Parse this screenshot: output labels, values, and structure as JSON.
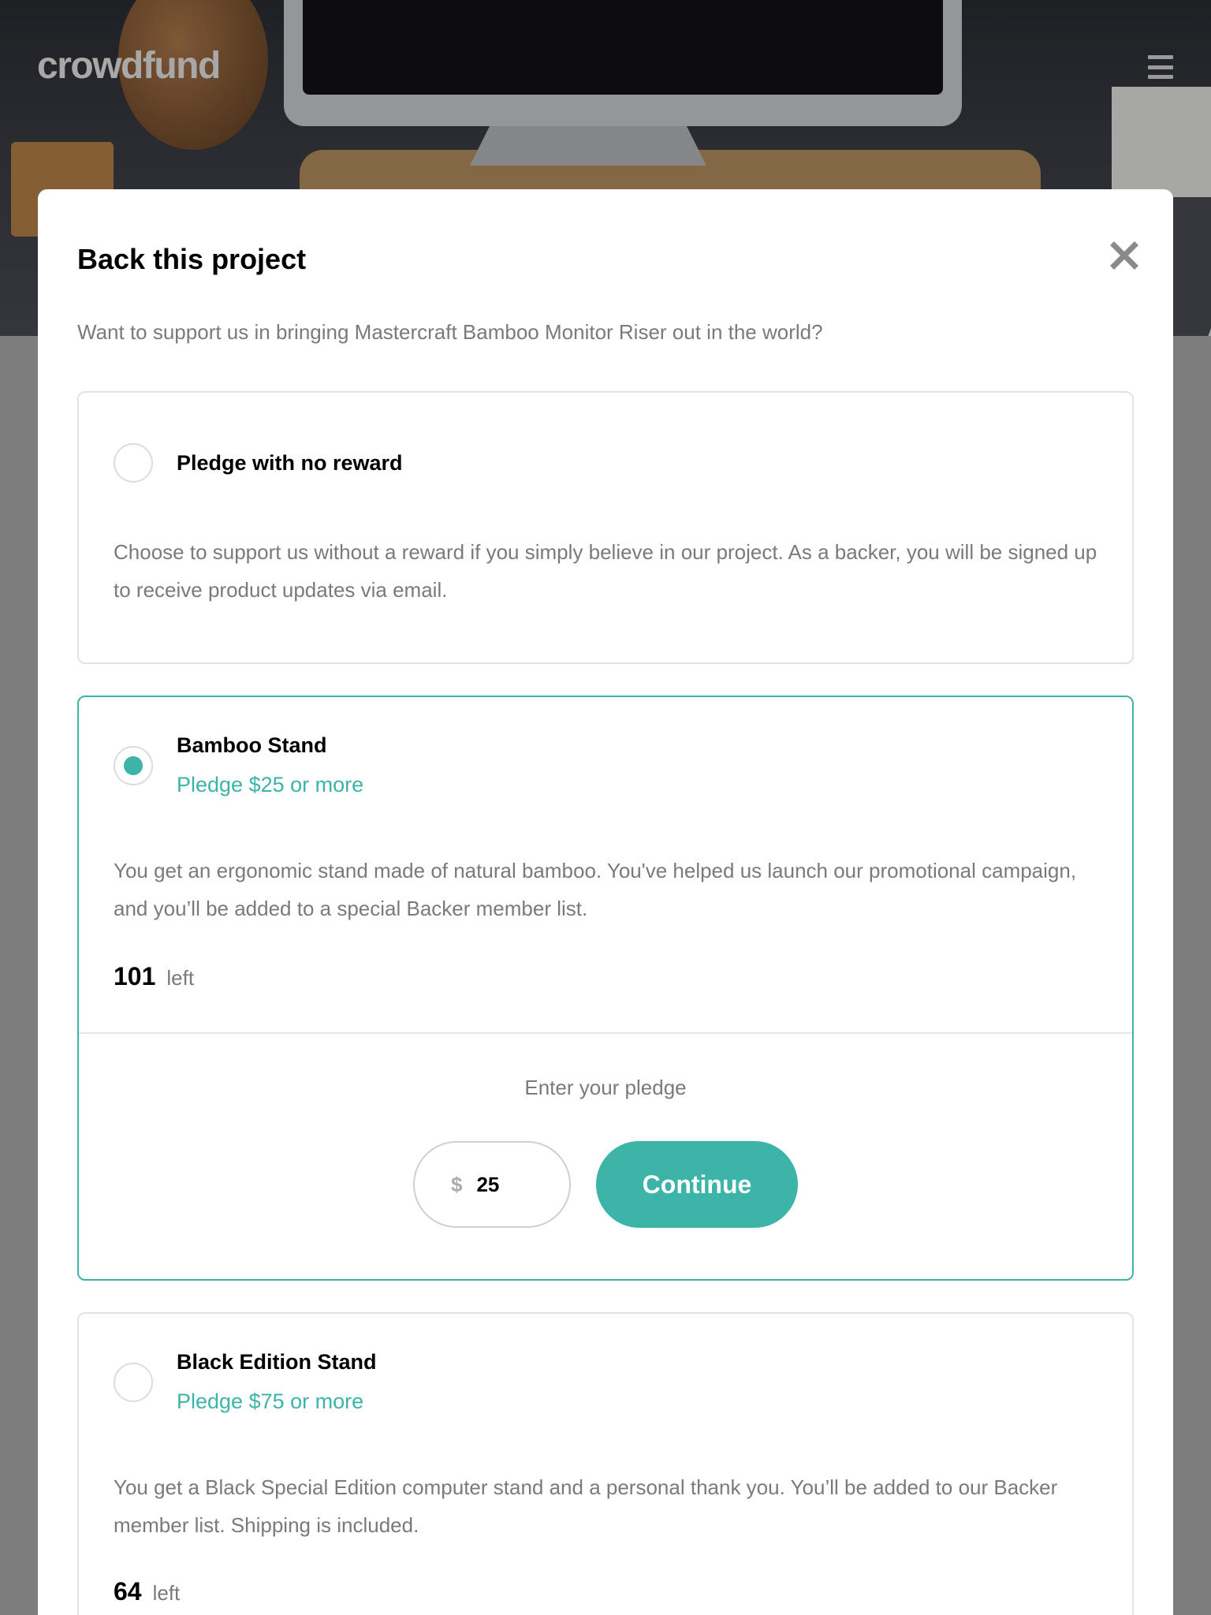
{
  "header": {
    "logo": "crowdfund",
    "menu_icon": "hamburger-menu-icon"
  },
  "modal": {
    "title": "Back this project",
    "close_icon": "close-icon",
    "subtitle": "Want to support us in bringing Mastercraft Bamboo Monitor Riser out in the world?"
  },
  "rewards": [
    {
      "title": "Pledge with no reward",
      "description": "Choose to support us without a reward if you simply believe in our project. As a backer, you will be signed up to receive product updates via email.",
      "selected": false
    },
    {
      "title": "Bamboo Stand",
      "price": "Pledge $25 or more",
      "description": "You get an ergonomic stand made of natural bamboo. You've helped us launch our promotional campaign, and you’ll be added to a special Backer member list.",
      "left_count": "101",
      "left_label": "left",
      "selected": true
    },
    {
      "title": "Black Edition Stand",
      "price": "Pledge $75 or more",
      "description": "You get a Black Special Edition computer stand and a personal thank you. You’ll be added to our Backer member list. Shipping is included.",
      "left_count": "64",
      "left_label": "left",
      "selected": false
    }
  ],
  "pledge": {
    "label": "Enter your pledge",
    "currency": "$",
    "amount": "25",
    "continue_label": "Continue"
  },
  "colors": {
    "accent": "#3cb4a8",
    "muted_text": "#7a7a7a",
    "backdrop": "#7d7d7d"
  }
}
